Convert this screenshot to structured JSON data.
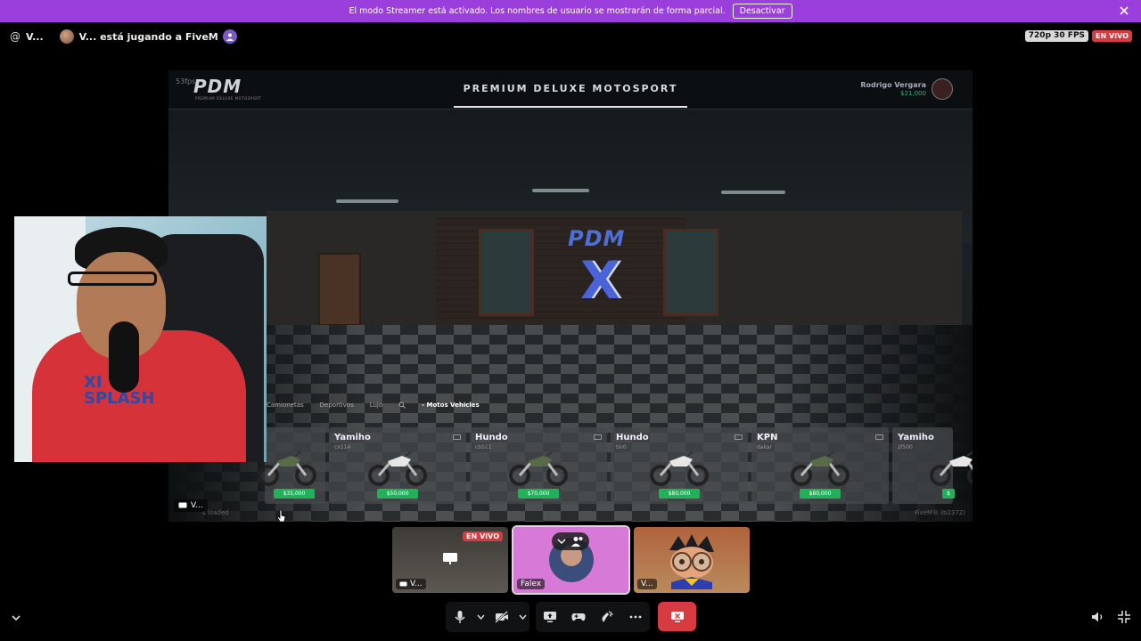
{
  "banner": {
    "text": "El modo Streamer está activado. Los nombres de usuario se mostrarán de forma parcial.",
    "button": "Desactivar"
  },
  "header": {
    "at_symbol": "@",
    "channel_user": "V...",
    "activity": "V... está jugando a FiveM",
    "quality": "720p 30 FPS",
    "live": "EN VIVO"
  },
  "game": {
    "fps": "53fps",
    "logo": "PDM",
    "logo_sub": "PREMIUM DELUXE MOTOSPORT",
    "title": "PREMIUM DELUXE MOTOSPORT",
    "user_name": "Rodrigo Vergara",
    "user_money": "$21,000",
    "wall_logo": "PDM",
    "wall_x": "X",
    "categories": [
      {
        "label": "Camionetas",
        "active": false
      },
      {
        "label": "Deportivos",
        "active": false
      },
      {
        "label": "Lujo",
        "active": false
      },
      {
        "label": "- Motos Vehicles",
        "active": true
      }
    ],
    "cards": [
      {
        "brand": "",
        "model": "",
        "price": "$35,000",
        "partial": true
      },
      {
        "brand": "Yamiho",
        "model": "cx114",
        "price": "$50,000",
        "partial": false
      },
      {
        "brand": "Hundo",
        "model": "cb511",
        "price": "$70,000",
        "partial": false
      },
      {
        "brand": "Hundo",
        "model": "tin0",
        "price": "$80,000",
        "partial": false
      },
      {
        "brand": "KPN",
        "model": "dakar",
        "price": "$80,000",
        "partial": false
      },
      {
        "brand": "Yamiho",
        "model": "zf500",
        "price": "$",
        "partial": true
      }
    ],
    "stream_tag": "V...",
    "footer_left": "s loaded",
    "footer_right": "FiveM® (b2372)"
  },
  "webcam": {
    "shirt_text": "XI\nSPLASH"
  },
  "tiles": [
    {
      "label": "V...",
      "live": "EN VIVO"
    },
    {
      "label": "Falex"
    },
    {
      "label": "V..."
    }
  ],
  "colors": {
    "banner": "#9b3fdc",
    "live": "#d83a42",
    "price": "#22b05a",
    "hangup": "#d83a42"
  }
}
